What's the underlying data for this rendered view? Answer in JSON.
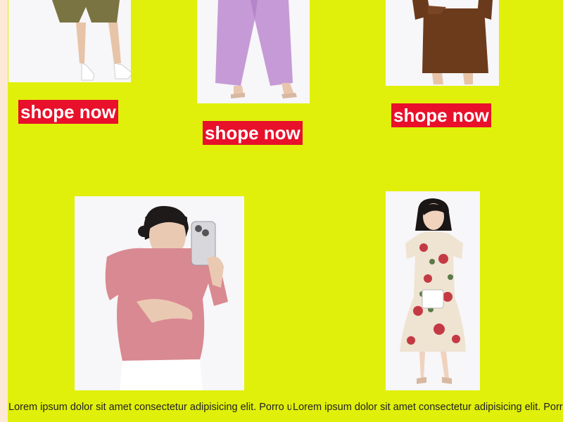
{
  "top_row": [
    {
      "image": "product-photo-shorts",
      "button_label": "shope now"
    },
    {
      "image": "product-photo-lilac-pants",
      "button_label": "shope now"
    },
    {
      "image": "product-photo-brown-skirt",
      "button_label": "shope now"
    }
  ],
  "bottom_row": [
    {
      "image": "product-photo-pink-top",
      "description": "Lorem ipsum dolor sit amet consectetur adipisicing elit. Porro unde blanditiis libero placeat? Reiciendis"
    },
    {
      "image": "product-photo-floral-dress",
      "description": "Lorem ipsum dolor sit amet consectetur adipisicing elit. Porro unde blanditiis libero placeat? Reiciendis"
    }
  ],
  "colors": {
    "page_background": "#e0f00a",
    "button_background": "#e8102a",
    "button_text": "#ffffff",
    "left_strip": "#fde9d6"
  }
}
